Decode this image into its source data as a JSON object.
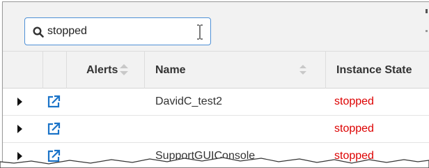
{
  "search": {
    "value": "stopped",
    "placeholder": ""
  },
  "table": {
    "columns": [
      "",
      "",
      "Alerts",
      "Name",
      "Instance State"
    ],
    "rows": [
      {
        "name": "DavidC_test2",
        "state": "stopped"
      },
      {
        "name": "",
        "state": "stopped"
      },
      {
        "name": "SupportGUIConsole",
        "state": "stopped"
      }
    ]
  },
  "colors": {
    "accent": "#1a73c8",
    "stopped": "#dd0000",
    "header_bg": "#f2f2f2"
  },
  "icons": [
    "search-icon",
    "text-cursor-icon",
    "sort-icon",
    "expand-arrow-icon",
    "external-link-icon"
  ]
}
